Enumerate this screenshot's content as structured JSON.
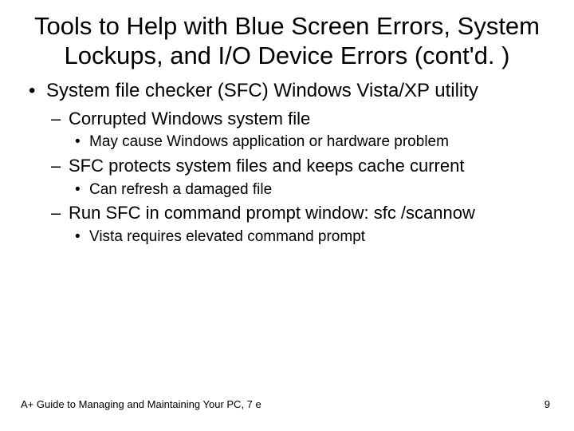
{
  "title": "Tools to Help with Blue Screen Errors, System Lockups, and I/O Device Errors (cont'd. )",
  "bullets": {
    "l1_0": "System file checker (SFC) Windows Vista/XP utility",
    "l2_0": "Corrupted Windows system file",
    "l3_0": "May cause Windows application or hardware problem",
    "l2_1": "SFC protects system files and keeps cache current",
    "l3_1": "Can refresh a damaged file",
    "l2_2": "Run SFC in command prompt window: sfc /scannow",
    "l3_2": "Vista requires elevated command prompt"
  },
  "footer": {
    "left": "A+ Guide to Managing and Maintaining Your PC, 7 e",
    "right": "9"
  }
}
